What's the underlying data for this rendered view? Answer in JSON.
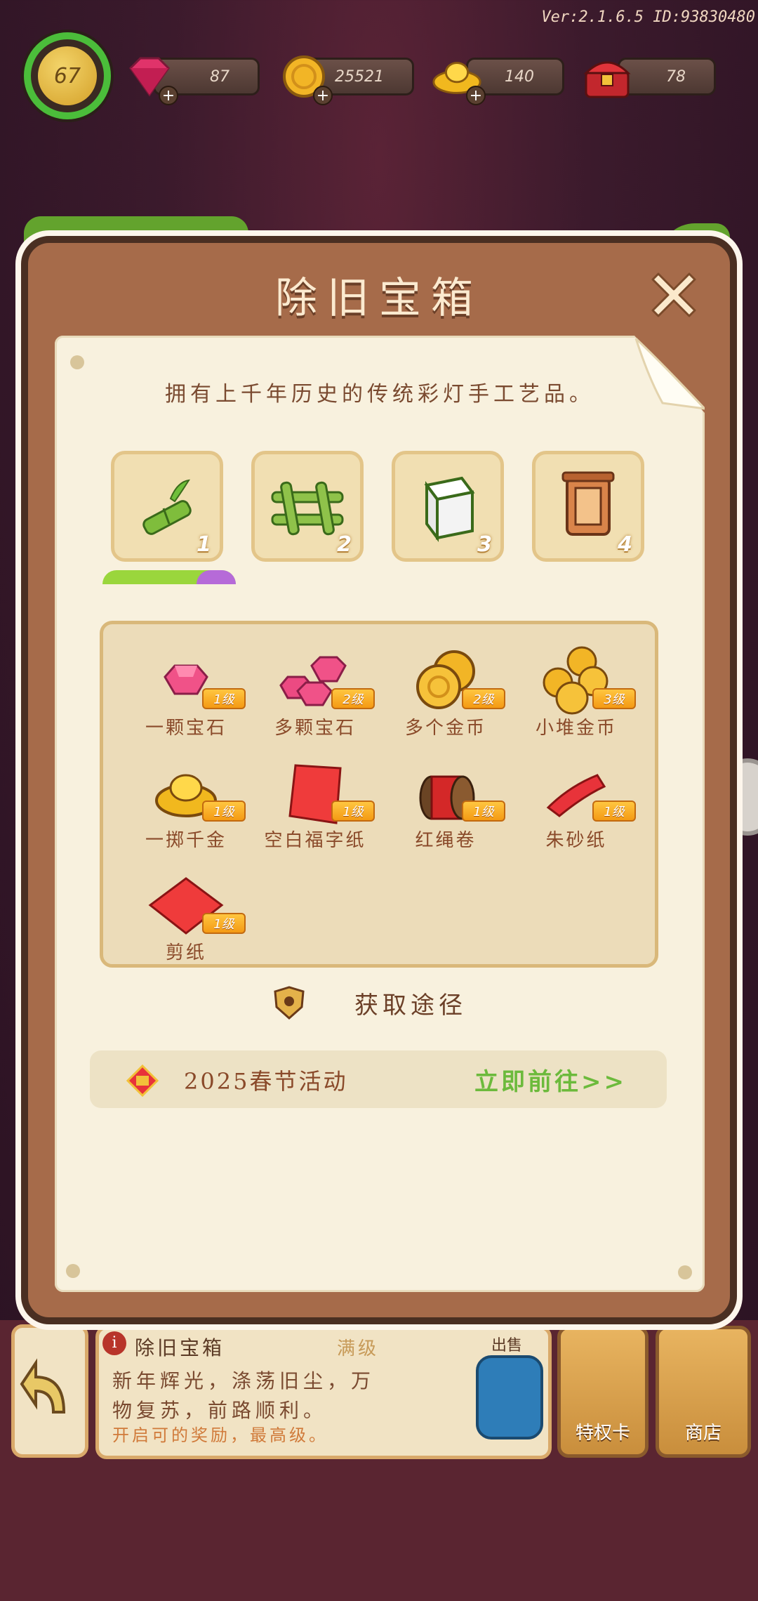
{
  "hud": {
    "version": "Ver:2.1.6.5 ID:93830480",
    "level": "67",
    "gems": "87",
    "coins": "25521",
    "ingots": "140",
    "chests": "78"
  },
  "modal": {
    "title": "除旧宝箱",
    "description": "拥有上千年历史的传统彩灯手工艺品。",
    "stages": [
      "1",
      "2",
      "3",
      "4"
    ],
    "rewards": [
      {
        "label": "一颗宝石",
        "badge": "1级",
        "icon": "single-gem-icon"
      },
      {
        "label": "多颗宝石",
        "badge": "2级",
        "icon": "multi-gem-icon"
      },
      {
        "label": "多个金币",
        "badge": "2级",
        "icon": "coins-icon"
      },
      {
        "label": "小堆金币",
        "badge": "3级",
        "icon": "coin-pile-icon"
      },
      {
        "label": "一掷千金",
        "badge": "1级",
        "icon": "gold-ingot-icon"
      },
      {
        "label": "空白福字纸",
        "badge": "1级",
        "icon": "red-paper-icon"
      },
      {
        "label": "红绳卷",
        "badge": "1级",
        "icon": "red-rope-icon"
      },
      {
        "label": "朱砂纸",
        "badge": "1级",
        "icon": "cinnabar-paper-icon"
      },
      {
        "label": "剪纸",
        "badge": "1级",
        "icon": "paper-cut-icon"
      }
    ],
    "source_title": "获取途径",
    "source_name": "2025春节活动",
    "source_go": "立即前往>>"
  },
  "background_card": {
    "title": "除旧宝箱",
    "level": "满级",
    "sell": "出售",
    "desc": "新年辉光，涤荡旧尘，万物复苏，前路顺利。",
    "note": "开启可的奖励，最高级。",
    "privilege_label": "特权卡",
    "shop_label": "商店"
  },
  "colors": {
    "accent_green": "#6cba3c",
    "modal_brown": "#a66b4a",
    "paper": "#f8f1de",
    "badge_orange": "#f49a14"
  }
}
